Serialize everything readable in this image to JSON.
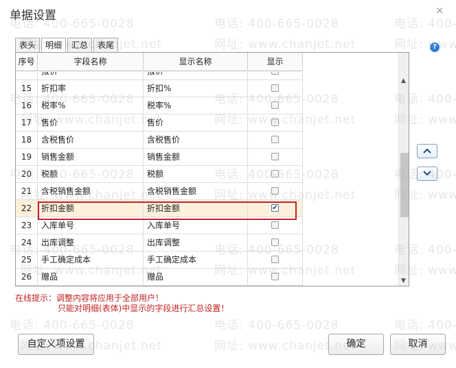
{
  "dialog": {
    "title": "单据设置",
    "close_glyph": "×",
    "help_glyph": "?"
  },
  "tabs": [
    {
      "label": "表头"
    },
    {
      "label": "明细",
      "active": true
    },
    {
      "label": "汇总"
    },
    {
      "label": "表尾"
    }
  ],
  "grid": {
    "columns": [
      "序号",
      "字段名称",
      "显示名称",
      "显示"
    ],
    "partial_row": {
      "field": "报价",
      "display": "报价",
      "checked": false
    },
    "rows": [
      {
        "no": "15",
        "field": "折扣率",
        "display": "折扣%",
        "checked": false
      },
      {
        "no": "16",
        "field": "税率%",
        "display": "税率%",
        "checked": false
      },
      {
        "no": "17",
        "field": "售价",
        "display": "售价",
        "checked": false
      },
      {
        "no": "18",
        "field": "含税售价",
        "display": "含税售价",
        "checked": false
      },
      {
        "no": "19",
        "field": "销售金额",
        "display": "销售金额",
        "checked": false
      },
      {
        "no": "20",
        "field": "税额",
        "display": "税额",
        "checked": false
      },
      {
        "no": "21",
        "field": "含税销售金额",
        "display": "含税销售金额",
        "checked": false
      },
      {
        "no": "22",
        "field": "折扣金额",
        "display": "折扣金额",
        "checked": true,
        "selected": true
      },
      {
        "no": "23",
        "field": "入库单号",
        "display": "入库单号",
        "checked": false
      },
      {
        "no": "24",
        "field": "出库调整",
        "display": "出库调整",
        "checked": false
      },
      {
        "no": "25",
        "field": "手工确定成本",
        "display": "手工确定成本",
        "checked": false
      },
      {
        "no": "26",
        "field": "赠品",
        "display": "赠品",
        "checked": false
      }
    ]
  },
  "side_buttons": {
    "up_icon": "arrow-up-icon",
    "down_icon": "arrow-down-icon"
  },
  "hint": {
    "line1": "在线提示：调整内容将应用于全部用户！",
    "line2": "只能对明细(表体)中显示的字段进行汇总设置！"
  },
  "buttons": {
    "custom": "自定义项设置",
    "ok": "确定",
    "cancel": "取消"
  },
  "watermark": {
    "phone": "电话: 400-665-0028",
    "site": "网址: www.chanjet.net"
  },
  "colors": {
    "highlight_border": "#c8202a",
    "selected_row": "#fdf1dc",
    "hint_text": "#c21f1f"
  }
}
